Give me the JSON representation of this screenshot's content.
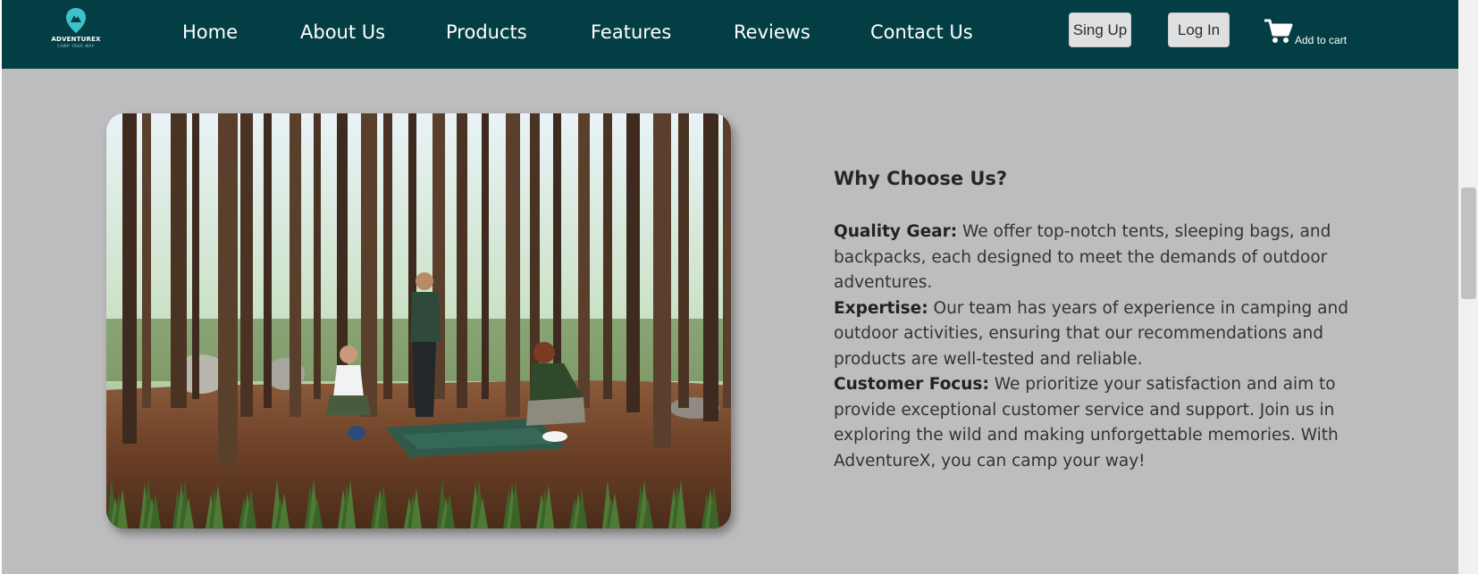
{
  "brand": {
    "name": "ADVENTUREX",
    "tagline": "CAMP YOUR WAY",
    "accent_color": "#3fc1c9",
    "navbar_color": "#043e45"
  },
  "nav": {
    "links": [
      "Home",
      "About Us",
      "Products",
      "Features",
      "Reviews",
      "Contact Us"
    ]
  },
  "auth": {
    "signup_label": "Sing Up",
    "login_label": "Log In"
  },
  "cart": {
    "icon": "shopping-cart-icon",
    "label": "Add to cart"
  },
  "hero_image": {
    "subject": "three campers laying out a green tarp among tall pine trees in a forest"
  },
  "why": {
    "heading": "Why Choose Us?",
    "items": [
      {
        "title": "Quality Gear:",
        "text": " We offer top-notch tents, sleeping bags, and backpacks, each designed to meet the demands of outdoor adventures."
      },
      {
        "title": "Expertise:",
        "text": " Our team has years of experience in camping and outdoor activities, ensuring that our recommendations and products are well-tested and reliable."
      },
      {
        "title": "Customer Focus:",
        "text": " We prioritize your satisfaction and aim to provide exceptional customer service and support. Join us in exploring the wild and making unforgettable memories. With AdventureX, you can camp your way!"
      }
    ]
  },
  "colors": {
    "page_background": "#bdbdbf",
    "button_background": "#dfe0e1"
  }
}
